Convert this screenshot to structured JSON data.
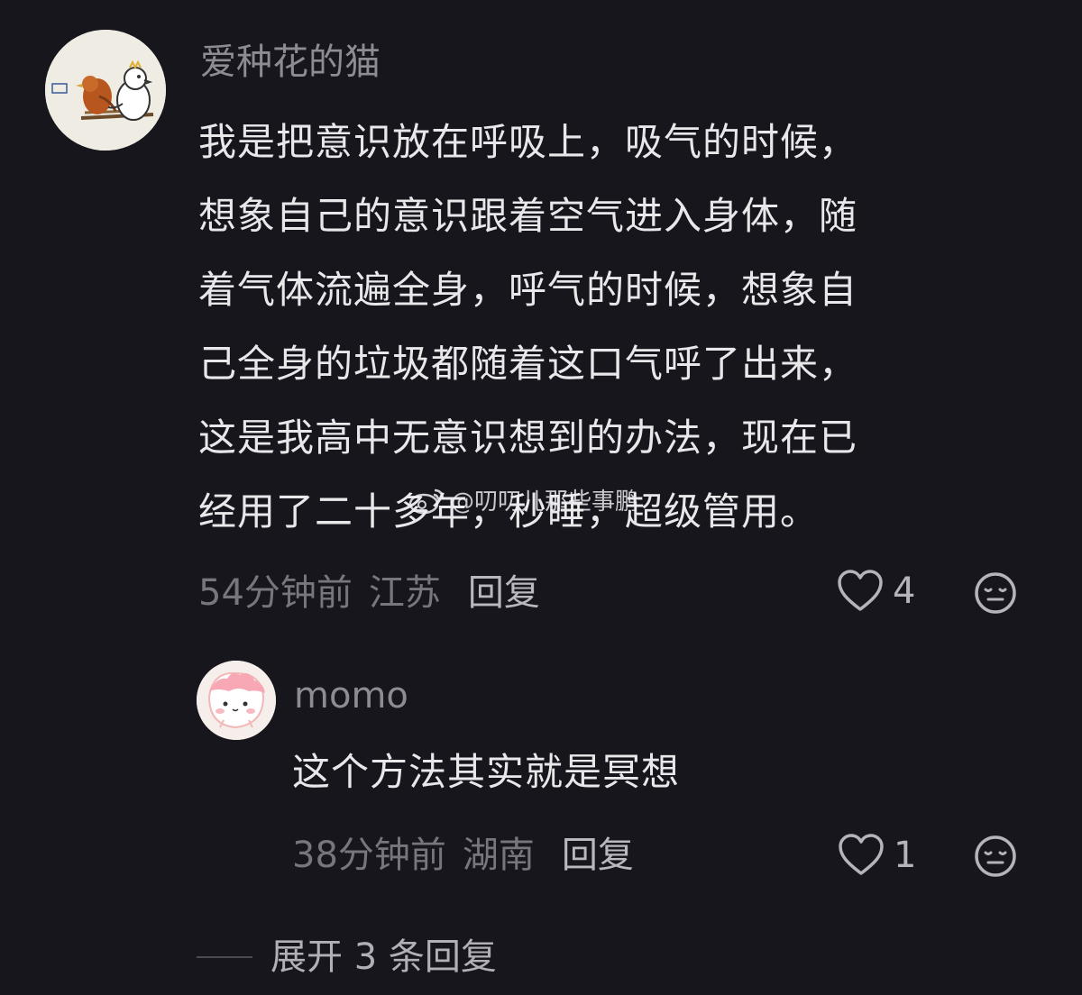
{
  "comment": {
    "username": "爱种花的猫",
    "avatar_icon": "bird-drawing-avatar",
    "lines": [
      "我是把意识放在呼吸上，吸气的时候，",
      "想象自己的意识跟着空气进入身体，随",
      "着气体流遍全身，呼气的时候，想象自",
      "己全身的垃圾都随着这口气呼了出来，",
      "这是我高中无意识想到的办法，现在已",
      "经用了二十多年，秒睡，超级管用。"
    ],
    "time": "54分钟前",
    "location": "江苏",
    "reply_label": "回复",
    "likes": "4"
  },
  "reply": {
    "username": "momo",
    "avatar_icon": "pink-cartoon-avatar",
    "text": "这个方法其实就是冥想",
    "time": "38分钟前",
    "location": "湖南",
    "reply_label": "回复",
    "likes": "1"
  },
  "expand_label": "展开 3 条回复",
  "watermark": "@叨叨儿那些事鹏",
  "colors": {
    "background": "#17161c",
    "text_primary": "#e8e8ea",
    "text_secondary": "#8d8c93",
    "meta": "#77767d"
  }
}
